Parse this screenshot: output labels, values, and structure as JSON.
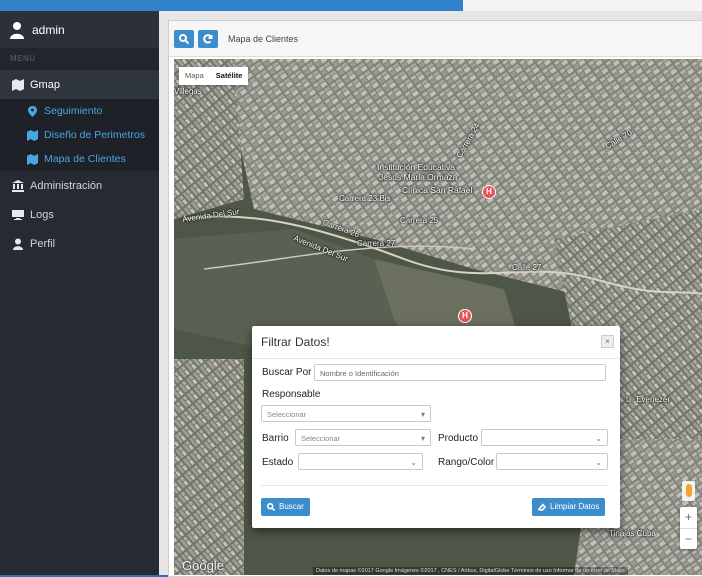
{
  "sidebar": {
    "user": "admin",
    "menu_header": "MENU",
    "items": [
      {
        "label": "Gmap"
      },
      {
        "label": "Administración"
      },
      {
        "label": "Logs"
      },
      {
        "label": "Perfil"
      }
    ],
    "sub_items": [
      {
        "label": "Seguimiento"
      },
      {
        "label": "Diseño de Perimetros"
      },
      {
        "label": "Mapa de Clientes"
      }
    ]
  },
  "header": {
    "title": "Mapa de Clientes"
  },
  "map": {
    "type_map": "Mapa",
    "type_satellite": "Satélite",
    "google": "Google",
    "attribution": "Datos de mapas ©2017 Google Imágenes ©2017 , CNES / Airbus, DigitalGlobe  Términos de uso  Informar de un error de Maps",
    "labels": {
      "l1": "Institución Educativa",
      "l2": "Jesus Maria Ormaza",
      "l3": "Clínica San Rafael",
      "l4": "Avenida Del Sur",
      "l5": "Avenida Del Sur",
      "l6": "Carrera 25",
      "l7": "Carrera 27",
      "l8": "Carrera 23 Bis",
      "l9": "Carrera 26",
      "l10": "Calle 27",
      "l11": "Villegas",
      "l12": "til. Evenezer",
      "l13": "Tinajas Cuba",
      "l14": "Carrera 24",
      "l15": "Calle 70"
    }
  },
  "modal": {
    "title": "Filtrar Datos!",
    "close": "×",
    "buscar_por_label": "Buscar Por",
    "buscar_por_placeholder": "Nombre o Identificación",
    "responsable_label": "Responsable",
    "responsable_value": "Seleccionar",
    "barrio_label": "Barrio",
    "barrio_value": "Seleccionar",
    "producto_label": "Producto",
    "producto_value": "",
    "estado_label": "Estado",
    "estado_value": "",
    "rango_label": "Rango/Color",
    "rango_value": "",
    "buscar_button": "Buscar",
    "limpiar_button": "Limpiar Datos"
  },
  "colors": {
    "accent": "#3c8dcb",
    "sidebar_bg": "#262b33",
    "sub_link": "#48a6e0"
  }
}
